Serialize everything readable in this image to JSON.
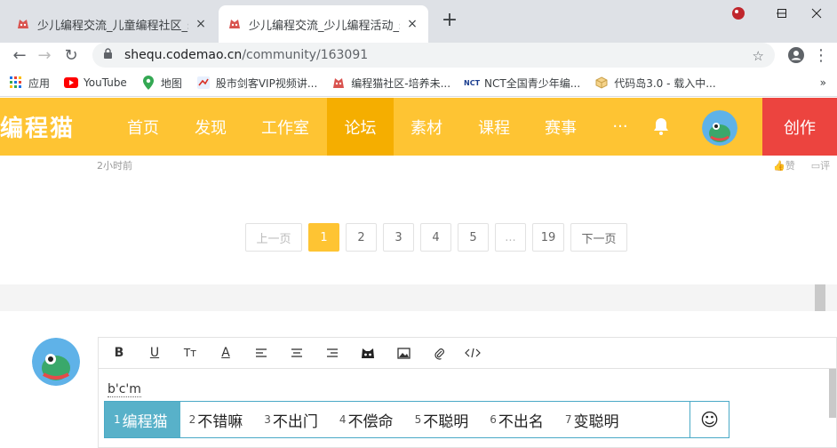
{
  "browser": {
    "tabs": [
      {
        "title": "少儿编程交流_儿童编程社区_scr",
        "active": false
      },
      {
        "title": "少儿编程交流_少儿编程活动_scra",
        "active": true
      }
    ],
    "new_tab": "+",
    "close": "×",
    "url_host": "shequ.codemao.cn",
    "url_path": "/community/163091",
    "bookmarks": [
      {
        "label": "应用",
        "icon": "apps-grid-icon"
      },
      {
        "label": "YouTube",
        "icon": "youtube-icon"
      },
      {
        "label": "地图",
        "icon": "maps-pin-icon"
      },
      {
        "label": "股市剑客VIP视频讲...",
        "icon": "stock-icon"
      },
      {
        "label": "编程猫社区-培养未...",
        "icon": "codemao-icon"
      },
      {
        "label": "NCT全国青少年编...",
        "icon": "nct-icon"
      },
      {
        "label": "代码岛3.0 - 载入中...",
        "icon": "cube-icon"
      }
    ],
    "bookmarks_more": "»"
  },
  "site": {
    "logo": "编程猫",
    "nav": [
      "首页",
      "发现",
      "工作室",
      "论坛",
      "素材",
      "课程",
      "赛事",
      "···"
    ],
    "active_nav": "论坛",
    "create": "创作"
  },
  "post": {
    "time": "2小时前",
    "like": "赞",
    "comment": "评"
  },
  "pagination": {
    "prev": "上一页",
    "pages": [
      "1",
      "2",
      "3",
      "4",
      "5",
      "...",
      "19"
    ],
    "current": "1",
    "next": "下一页"
  },
  "editor": {
    "toolbar": [
      "B",
      "U",
      "Tт",
      "A",
      "align-left",
      "align-center",
      "align-right",
      "cat-emoji",
      "image",
      "attach",
      "code"
    ],
    "text": "b'c'm"
  },
  "ime": {
    "candidates": [
      {
        "num": "1",
        "text": "编程猫"
      },
      {
        "num": "2",
        "text": "不错嘛"
      },
      {
        "num": "3",
        "text": "不出门"
      },
      {
        "num": "4",
        "text": "不偿命"
      },
      {
        "num": "5",
        "text": "不聪明"
      },
      {
        "num": "6",
        "text": "不出名"
      },
      {
        "num": "7",
        "text": "变聪明"
      }
    ],
    "smiley": "☺"
  },
  "colors": {
    "brand": "#fec433",
    "brand_active": "#f5ae00",
    "create": "#ec443f",
    "ime_select": "#58b1c9"
  }
}
